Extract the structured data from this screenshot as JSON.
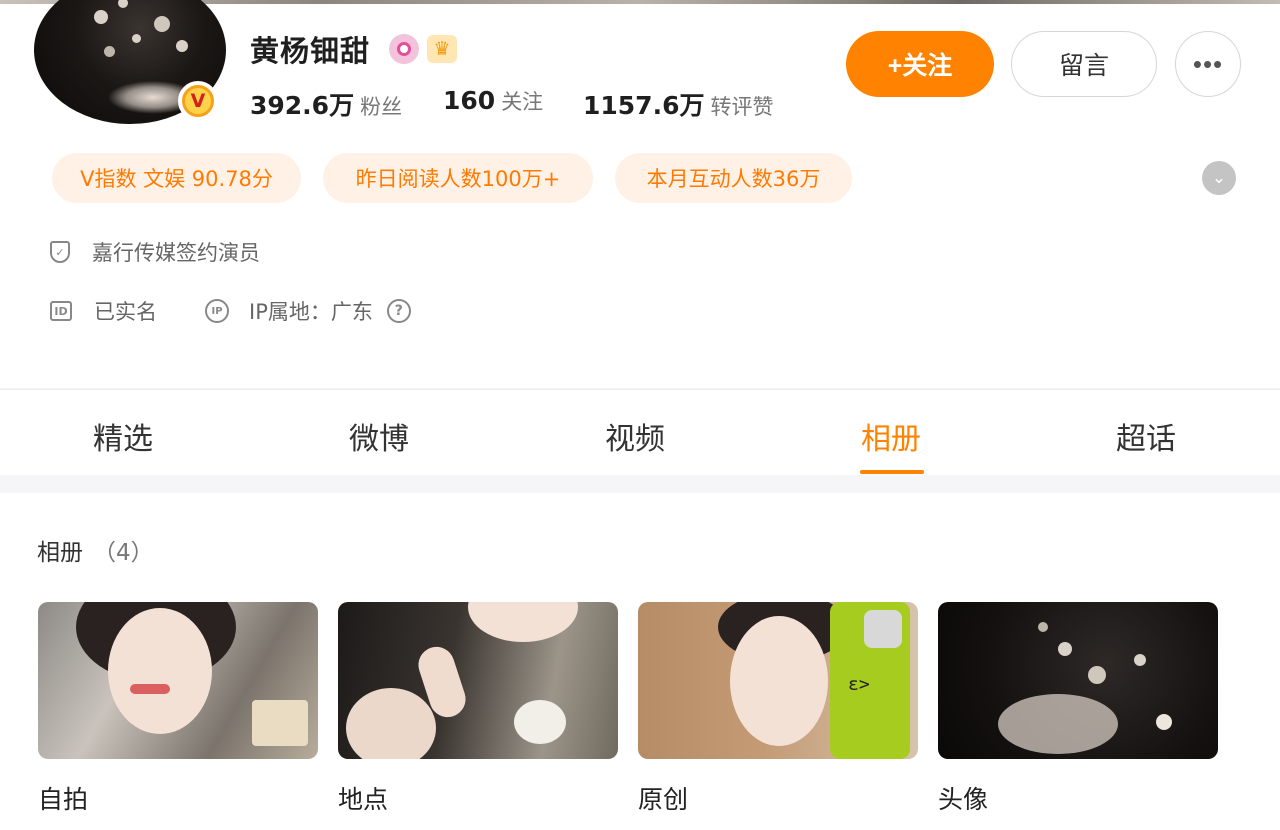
{
  "profile": {
    "name": "黄杨钿甜",
    "verified_badge": "V",
    "gender_icon": "female-badge-icon",
    "member_icon": "crown-icon",
    "stats": [
      {
        "value": "392.6万",
        "label": "粉丝"
      },
      {
        "value": "160",
        "label": "关注"
      },
      {
        "value": "1157.6万",
        "label": "转评赞"
      }
    ],
    "follow_label": "+关注",
    "message_label": "留言",
    "more_label": "•••",
    "pills": [
      "V指数 文娱 90.78分",
      "昨日阅读人数100万+",
      "本月互动人数36万"
    ],
    "expand_icon": "chevron-down-icon",
    "agency": "嘉行传媒签约演员",
    "real_name": "已实名",
    "ip_location": "IP属地：广东",
    "help_icon": "question-icon"
  },
  "tabs": [
    {
      "label": "精选"
    },
    {
      "label": "微博"
    },
    {
      "label": "视频"
    },
    {
      "label": "相册",
      "active": true
    },
    {
      "label": "超话"
    }
  ],
  "albums": {
    "title": "相册",
    "count": "（4）",
    "items": [
      {
        "label": "自拍"
      },
      {
        "label": "地点"
      },
      {
        "label": "原创"
      },
      {
        "label": "头像"
      }
    ]
  },
  "colors": {
    "accent": "#ff8200",
    "pill_bg": "#fff1e6",
    "pill_text": "#ff7a00"
  }
}
